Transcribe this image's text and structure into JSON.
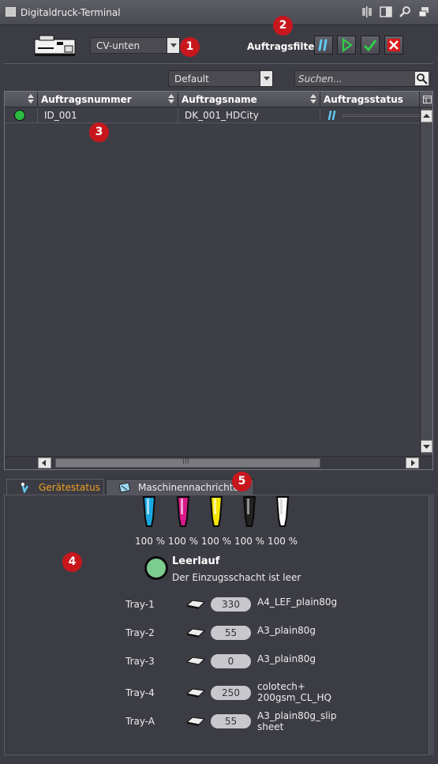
{
  "window": {
    "title": "Digitaldruck-Terminal"
  },
  "device_select": {
    "value": "CV-unten"
  },
  "filter": {
    "label": "Auftragsfilter",
    "buttons": [
      "pause-filter",
      "play-filter",
      "check-filter",
      "cancel-filter"
    ]
  },
  "view_select": {
    "value": "Default"
  },
  "search": {
    "placeholder": "Suchen..."
  },
  "table": {
    "columns": [
      "Auftragsnummer",
      "Auftragsname",
      "Auftragsstatus"
    ],
    "rows": [
      {
        "status_color": "#2dbb40",
        "number": "ID_001",
        "name": "DK_001_HDCity",
        "status": "paused"
      }
    ]
  },
  "tabs": [
    {
      "label": "Gerätestatus",
      "active": true
    },
    {
      "label": "Maschinennachrichten",
      "active": false
    }
  ],
  "toners": [
    {
      "color": "#19a8e0",
      "percent": "100 %"
    },
    {
      "color": "#d81a8a",
      "percent": "100 %"
    },
    {
      "color": "#f4e600",
      "percent": "100 %"
    },
    {
      "color": "#222222",
      "percent": "100 %"
    },
    {
      "color": "#ffffff",
      "percent": "100 %"
    }
  ],
  "device_status": {
    "title": "Leerlauf",
    "message": "Der Einzugsschacht ist leer"
  },
  "trays": [
    {
      "name": "Tray-1",
      "count": "330",
      "media": "A4_LEF_plain80g"
    },
    {
      "name": "Tray-2",
      "count": "55",
      "media": "A3_plain80g"
    },
    {
      "name": "Tray-3",
      "count": "0",
      "media": "A3_plain80g"
    },
    {
      "name": "Tray-4",
      "count": "250",
      "media": "colotech+ 200gsm_CL_HQ"
    },
    {
      "name": "Tray-A",
      "count": "55",
      "media": "A3_plain80g_slip sheet"
    }
  ],
  "badges": [
    "1",
    "2",
    "3",
    "4",
    "5"
  ]
}
